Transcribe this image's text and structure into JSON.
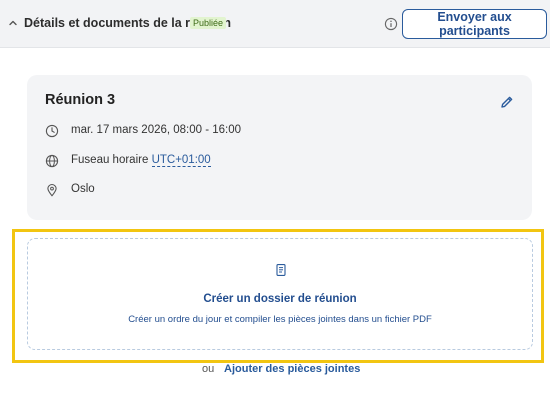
{
  "header": {
    "section_title": "Détails et documents de la réunion",
    "status_badge": "Publiée",
    "send_button_label": "Envoyer aux participants",
    "icons": {
      "toggle": "chevron-up-icon",
      "info": "info-icon"
    }
  },
  "meeting": {
    "title": "Réunion 3",
    "datetime": "mar. 17 mars 2026, 08:00 - 16:00",
    "timezone_label": "Fuseau horaire",
    "timezone_value": "UTC+01:00",
    "location": "Oslo",
    "icons": {
      "edit": "pencil-icon",
      "datetime": "clock-icon",
      "timezone": "globe-icon",
      "location": "map-pin-icon"
    }
  },
  "dossier": {
    "title": "Créer un dossier de réunion",
    "description": "Créer un ordre du jour et compiler les pièces jointes dans un fichier PDF",
    "icon": "document-icon"
  },
  "attachments": {
    "or_label": "ou",
    "link_label": "Ajouter des pièces jointes"
  },
  "colors": {
    "accent": "#2a5b9c",
    "highlight": "#f2c511",
    "badge_bg": "#e2f4cf",
    "badge_text": "#3d6b17",
    "card_bg": "#f3f4f6"
  }
}
